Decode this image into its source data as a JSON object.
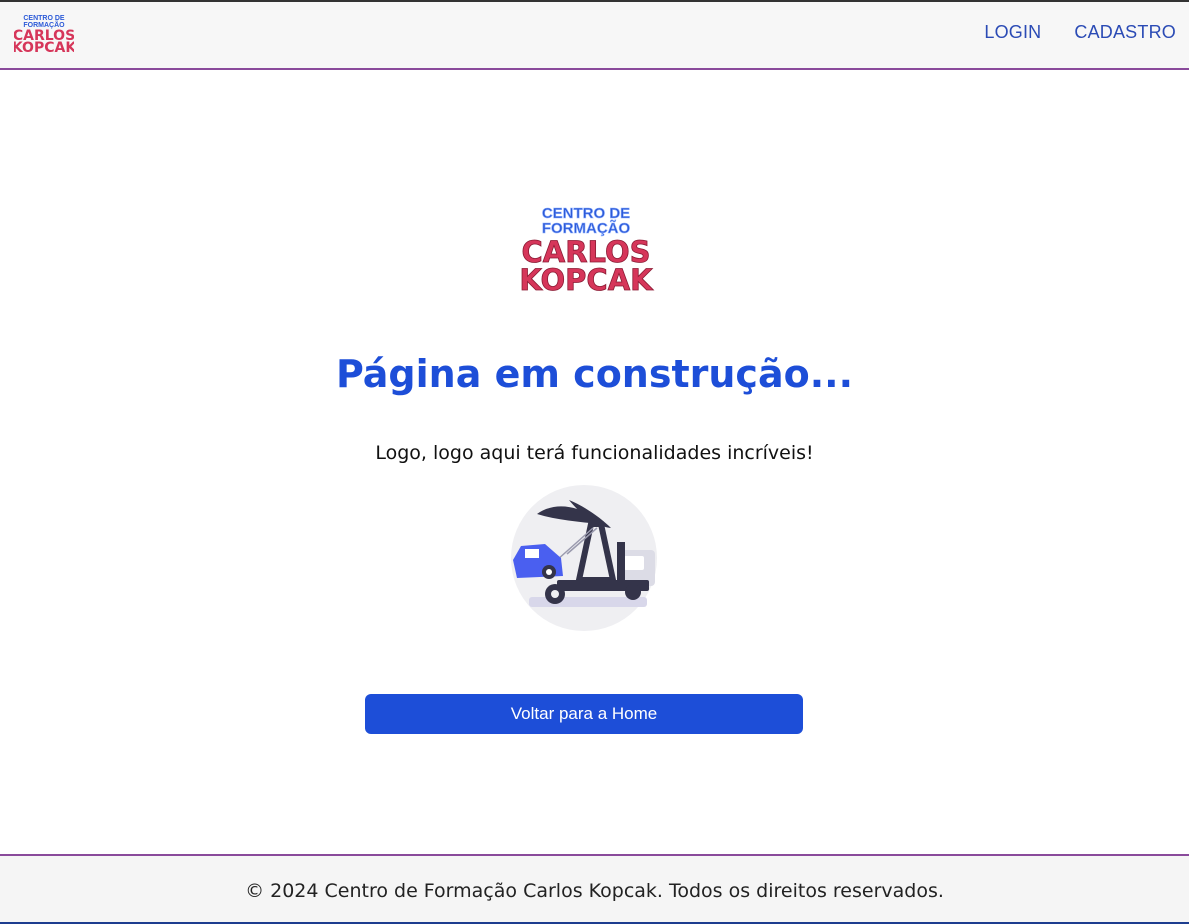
{
  "brand": {
    "logo_line1": "CENTRO DE",
    "logo_line2": "FORMAÇÃO",
    "logo_line3": "CARLOS",
    "logo_line4": "KOPCAK",
    "logo_blue": "#2d5bd8",
    "logo_red": "#d6365a"
  },
  "nav": {
    "login_label": "LOGIN",
    "signup_label": "CADASTRO"
  },
  "main": {
    "title": "Página em construção...",
    "subtitle": "Logo, logo aqui terá funcionalidades incríveis!",
    "illustration_icon": "tow-truck-illustration",
    "button_label": "Voltar para a Home"
  },
  "footer": {
    "text": "© 2024 Centro de Formação Carlos Kopcak. Todos os direitos reservados."
  },
  "colors": {
    "primary": "#1d4ed8",
    "nav_link": "#2b4bb5",
    "divider": "#8a4a9b"
  }
}
